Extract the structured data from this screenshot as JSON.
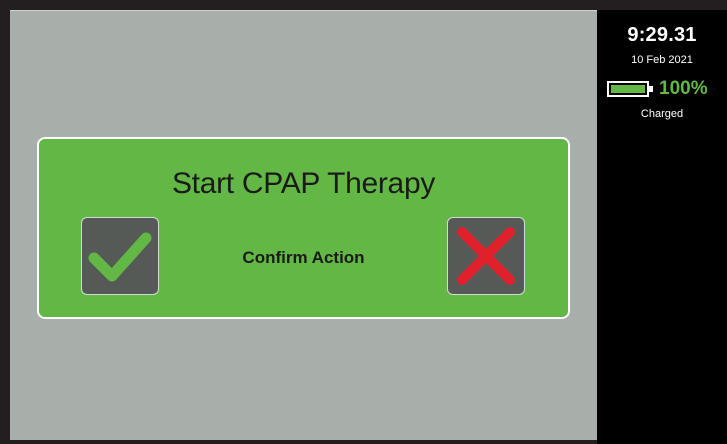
{
  "status_panel": {
    "time": "9:29.31",
    "date": "10 Feb 2021",
    "battery": {
      "percent_label": "100%",
      "level": 1.0,
      "status": "Charged",
      "color": "#63b845"
    }
  },
  "dialog": {
    "title": "Start CPAP Therapy",
    "prompt": "Confirm Action",
    "confirm_icon": "checkmark-icon",
    "cancel_icon": "x-icon",
    "colors": {
      "background": "#63b845",
      "confirm": "#63b845",
      "cancel": "#e0202a"
    }
  }
}
